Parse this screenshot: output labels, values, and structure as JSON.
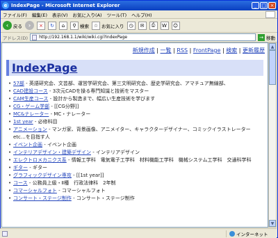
{
  "window": {
    "title": "IndexPage - Microsoft Internet Explorer"
  },
  "menu": [
    "ファイル(F)",
    "編集(E)",
    "表示(V)",
    "お気に入り(A)",
    "ツール(T)",
    "ヘルプ(H)"
  ],
  "toolbar": {
    "back_label": "戻る",
    "search_label": "検索",
    "favorites_label": "お気に入り"
  },
  "address": {
    "label": "アドレス(D)",
    "url": "http://192.168.1.1/wiki/wiki.cgi?IndexPage",
    "go_label": "移動"
  },
  "nav": {
    "new": "新規作成",
    "list": "一覧",
    "rss": "RSS",
    "frontpage": "FrontPage",
    "search": "検索",
    "history": "更新履歴"
  },
  "page": {
    "heading": "IndexPage"
  },
  "items": [
    {
      "link": "57部",
      "text": " - 英語研究会、文芸部、運営学研究会、第三文明研究会、歴史学研究会、アマチュア無線部、"
    },
    {
      "link": "CAD建設コース",
      "text": " - 3次元CADを操る専門知識と技術をマスター"
    },
    {
      "link": "CAM生産コース",
      "text": " - 設計から製造まで、幅広い生産技術を学びます"
    },
    {
      "link": "CG・ゲーム学部",
      "text": " - [[CG分野]]"
    },
    {
      "link": "MC&ナレーター",
      "text": " - MC・ナレーター"
    },
    {
      "link": "1st year",
      "text": " - 必修科目"
    },
    {
      "link": "アニメーション",
      "text": " - マンガ家、背景画像、アニメイター、キャラクターデザイナー、コミックイラストレーター etc…を目指す人"
    },
    {
      "link": "イベント企画",
      "text": " - イベント企画"
    },
    {
      "link": "インテリアデザイン・建築デザイン",
      "text": " - インテリアデザイン"
    },
    {
      "link": "エレクトロメカニクス系",
      "text": " - 情報工学科　電気電子工学科　材料機能工学科　機械システム工学科　交通科学科"
    },
    {
      "link": "ギター",
      "text": " - ギター"
    },
    {
      "link": "グラフィックデザイン専攻",
      "text": " - [[1st year]]"
    },
    {
      "link": "コース",
      "text": " - 公務員上級・Ⅱ種　行政法律科　2年制"
    },
    {
      "link": "コマーシャルフォト",
      "text": " - コマーシャルフォト"
    },
    {
      "link": "コンサート・ステージ制作",
      "text": " - コンサート・ステージ制作"
    }
  ],
  "status": {
    "zone": "インターネット"
  }
}
